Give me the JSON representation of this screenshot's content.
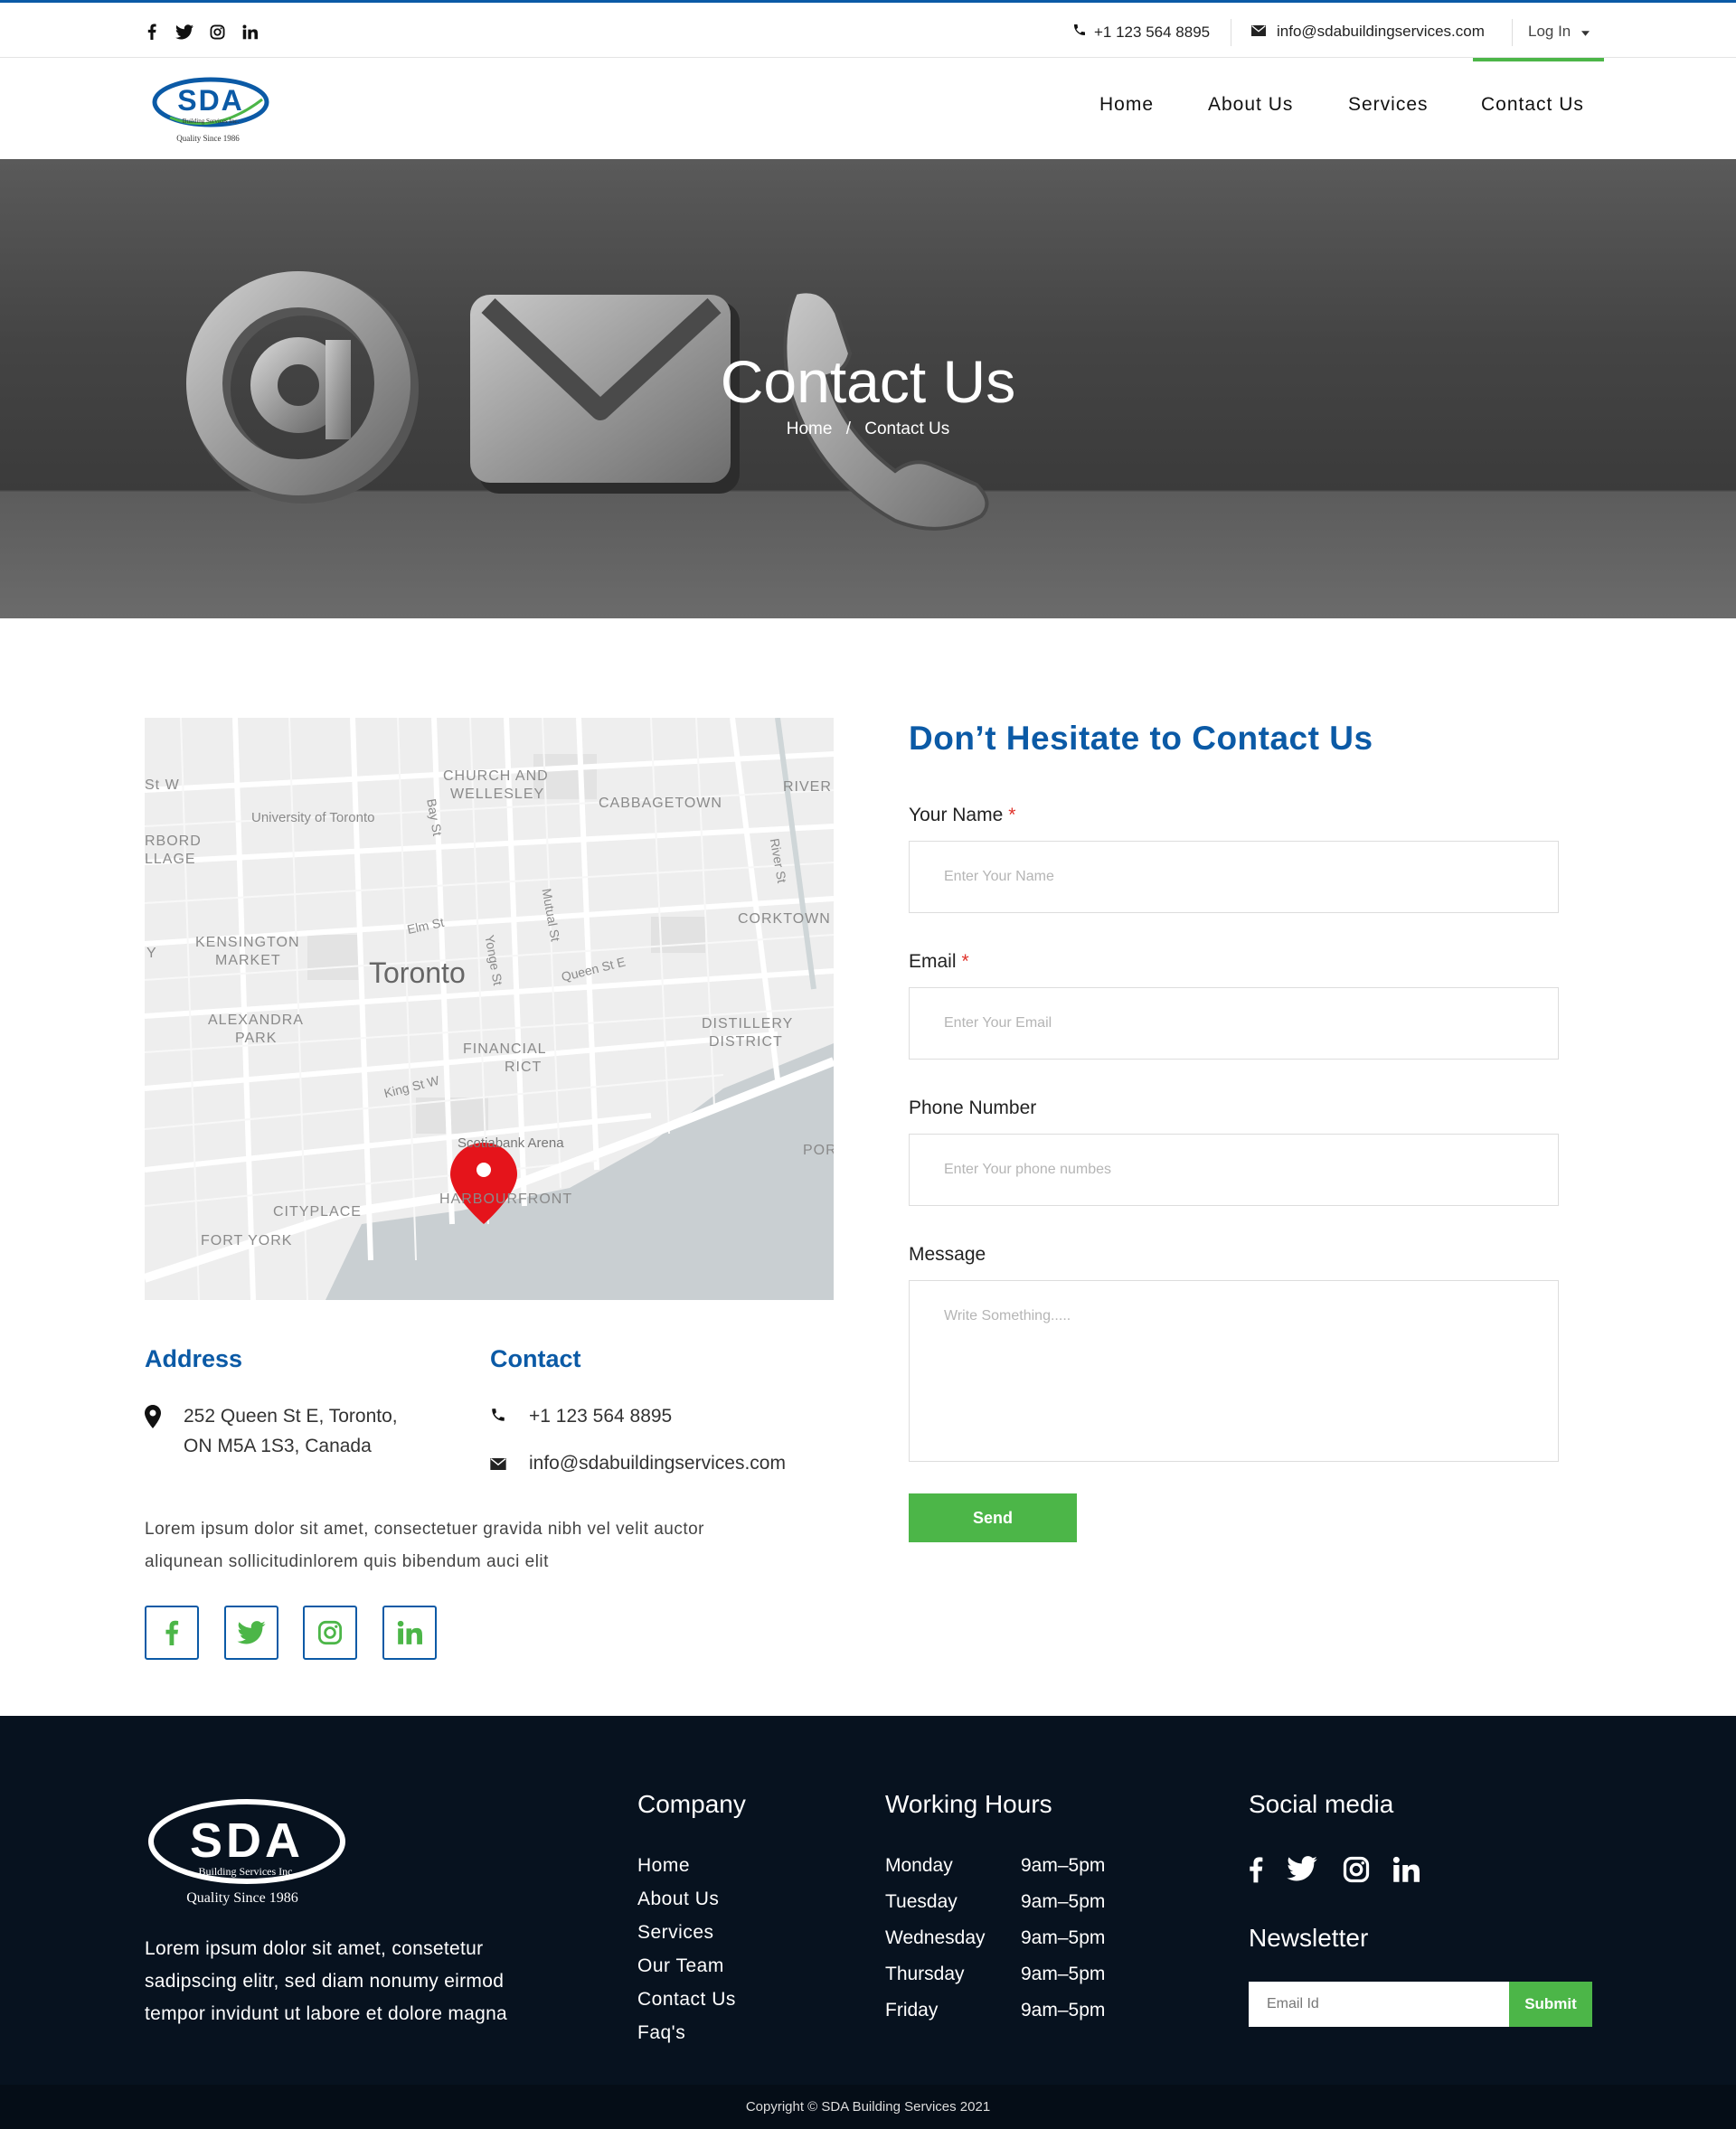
{
  "topbar": {
    "social_icons": [
      "facebook-icon",
      "twitter-icon",
      "instagram-icon",
      "linkedin-icon"
    ],
    "phone": "+1 123 564 8895",
    "email": "info@sdabuildingservices.com",
    "login": "Log In"
  },
  "brand": {
    "logo_text": "SDA",
    "logo_sub": "Building Services Inc.",
    "logo_tag": "Quality Since 1986",
    "blue": "#0b5aa6",
    "green": "#4cb648"
  },
  "nav": {
    "items": [
      "Home",
      "About Us",
      "Services",
      "Contact Us"
    ],
    "active": "Contact Us"
  },
  "hero": {
    "title": "Contact Us",
    "crumb_home": "Home",
    "crumb_sep": "/",
    "crumb_current": "Contact Us"
  },
  "map": {
    "labels": {
      "church": "CHURCH AND",
      "wellesley": "WELLESLEY",
      "cabbagetown": "CABBAGETOWN",
      "river": "RIVER",
      "uoft": "University of Toronto",
      "bay": "Bay St",
      "river_st": "River St",
      "rbord": "RBORD",
      "llage": "LLAGE",
      "corktown": "CORKTOWN",
      "kensington": "KENSINGTON",
      "market": "MARKET",
      "elm": "Elm St",
      "mutual": "Mutual St",
      "toronto": "Toronto",
      "yonge": "Yonge St",
      "queen": "Queen St E",
      "alexandra": "ALEXANDRA",
      "park": "PARK",
      "distillery": "DISTILLERY",
      "district": "DISTRICT",
      "financial": "FINANCIAL",
      "rict": "RICT",
      "king": "King St W",
      "scotiabank": "Scotiabank Arena",
      "por": "POR",
      "harbourfront": "HARBOURFRONT",
      "cityplace": "CITYPLACE",
      "fortyork": "FORT YORK",
      "stw": "St W",
      "y": "Y"
    }
  },
  "address": {
    "heading": "Address",
    "line1": "252 Queen St E, Toronto,",
    "line2": "ON M5A 1S3, Canada"
  },
  "contact": {
    "heading": "Contact",
    "phone": "+1 123 564 8895",
    "email": "info@sdabuildingservices.com"
  },
  "about_text": {
    "line1": "Lorem ipsum dolor sit amet, consectetuer gravida nibh vel velit auctor",
    "line2": "aliqunean sollicitudinlorem quis bibendum auci elit"
  },
  "social_boxes": [
    "facebook-icon",
    "twitter-icon",
    "instagram-icon",
    "linkedin-icon"
  ],
  "form": {
    "title": "Don’t Hesitate to Contact Us",
    "name_label": "Your Name",
    "name_placeholder": "Enter Your Name",
    "email_label": "Email",
    "email_placeholder": "Enter Your Email",
    "phone_label": "Phone Number",
    "phone_placeholder": "Enter Your phone numbes",
    "message_label": "Message",
    "message_placeholder": "Write Something.....",
    "required_mark": "*",
    "send": "Send"
  },
  "footer": {
    "about": {
      "line1": "Lorem ipsum dolor sit amet, consetetur",
      "line2": "sadipscing elitr, sed diam nonumy eirmod",
      "line3": "tempor invidunt ut labore et dolore magna"
    },
    "company_heading": "Company",
    "company_links": [
      "Home",
      "About Us",
      "Services",
      "Our Team",
      "Contact Us",
      "Faq's"
    ],
    "hours_heading": "Working Hours",
    "hours": [
      {
        "day": "Monday",
        "time": "9am–5pm"
      },
      {
        "day": "Tuesday",
        "time": "9am–5pm"
      },
      {
        "day": "Wednesday",
        "time": "9am–5pm"
      },
      {
        "day": "Thursday",
        "time": "9am–5pm"
      },
      {
        "day": "Friday",
        "time": "9am–5pm"
      }
    ],
    "social_heading": "Social media",
    "newsletter_heading": "Newsletter",
    "newsletter_placeholder": "Email Id",
    "newsletter_submit": "Submit",
    "copyright": "Copyright © SDA Building Services 2021"
  }
}
